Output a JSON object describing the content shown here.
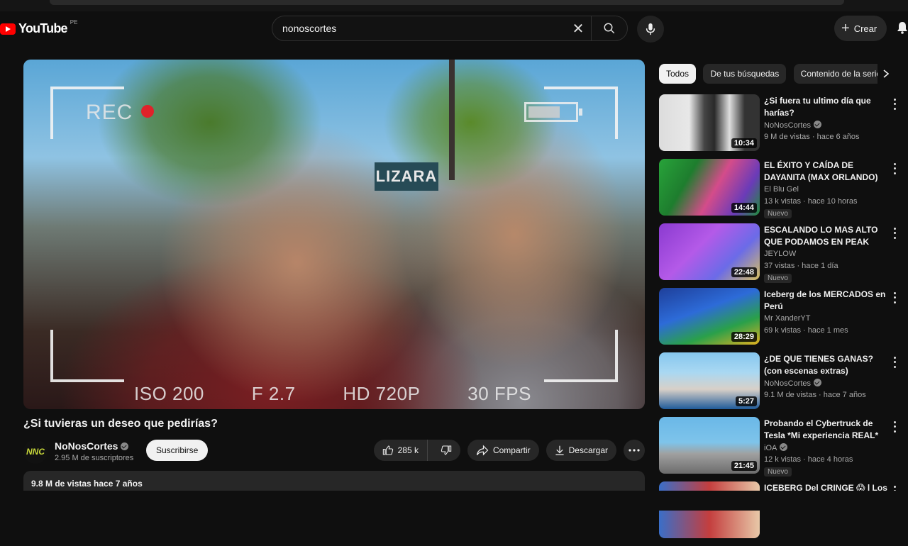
{
  "header": {
    "logo_text": "YouTube",
    "country_code": "PE",
    "search_value": "nonoscortes",
    "create_label": "Crear"
  },
  "player": {
    "overlay_rec": "REC",
    "overlay_stats": [
      "ISO 200",
      "F 2.7",
      "HD 720P",
      "30 FPS"
    ],
    "sign_text": "LIZARA"
  },
  "video": {
    "title": "¿Si tuvieras un deseo que pedirías?",
    "channel_name": "NoNosCortes",
    "channel_avatar_text": "NNC",
    "subscribers": "2.95 M de suscriptores",
    "subscribe_label": "Suscribirse",
    "likes": "285 k",
    "share_label": "Compartir",
    "download_label": "Descargar",
    "views_date": "9.8 M de vistas  hace 7 años"
  },
  "chips": [
    "Todos",
    "De tus búsquedas",
    "Contenido de la serie"
  ],
  "recommendations": [
    {
      "title": "¿Si fuera tu ultimo día que harías?",
      "channel": "NoNosCortes",
      "verified": true,
      "meta": "9 M de vistas · hace 6 años",
      "duration": "10:34",
      "badge": "",
      "thumb": "t0"
    },
    {
      "title": "EL ÉXITO Y CAÍDA DE DAYANITA (MAX ORLANDO)",
      "channel": "El Blu Gel",
      "verified": false,
      "meta": "13 k vistas · hace 10 horas",
      "duration": "14:44",
      "badge": "Nuevo",
      "thumb": "t1"
    },
    {
      "title": "ESCALANDO LO MAS ALTO QUE PODAMOS EN PEAK",
      "channel": "JEYLOW",
      "verified": false,
      "meta": "37 vistas · hace 1 día",
      "duration": "22:48",
      "badge": "Nuevo",
      "thumb": "t2"
    },
    {
      "title": "Iceberg de los MERCADOS en Perú",
      "channel": "Mr XanderYT",
      "verified": false,
      "meta": "69 k vistas · hace 1 mes",
      "duration": "28:29",
      "badge": "",
      "thumb": "t3"
    },
    {
      "title": "¿DE QUE TIENES GANAS? (con escenas extras)",
      "channel": "NoNosCortes",
      "verified": true,
      "meta": "9.1 M de vistas · hace 7 años",
      "duration": "5:27",
      "badge": "",
      "thumb": "t4"
    },
    {
      "title": "Probando el Cybertruck de Tesla *Mi experiencia REAL*",
      "channel": "iOA",
      "verified": true,
      "meta": "12 k vistas · hace 4 horas",
      "duration": "21:45",
      "badge": "Nuevo",
      "thumb": "t5"
    },
    {
      "title": "ICEBERG Del CRINGE 😱 | Los Momentos Más Penosos Que",
      "channel": "",
      "verified": false,
      "meta": "",
      "duration": "",
      "badge": "",
      "thumb": "t6"
    }
  ]
}
